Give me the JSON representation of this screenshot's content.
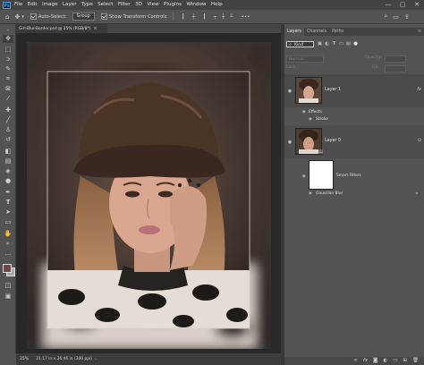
{
  "menubar": {
    "logo": "Ps",
    "items": [
      "File",
      "Edit",
      "Image",
      "Layer",
      "Type",
      "Select",
      "Filter",
      "3D",
      "View",
      "Plugins",
      "Window",
      "Help"
    ],
    "window_controls": [
      "—",
      "▢",
      "✕"
    ]
  },
  "options": {
    "auto_select_label": "Auto-Select:",
    "auto_select_value": "Group",
    "show_transform_label": "Show Transform Controls"
  },
  "document": {
    "tab_title": "Girl-Blur-Border.psd @ 25% (RGB/8*)",
    "zoom": "25%",
    "doc_info": "21.17 in x 26.46 in (300 ppi)"
  },
  "panels": {
    "tabs": [
      "Layers",
      "Channels",
      "Paths"
    ],
    "active_tab": "Layers",
    "filter_kind": "Kind",
    "blend_mode": "Normal",
    "opacity_label": "Opacity:",
    "fill_label": "Fill:",
    "lock_label": "Lock:",
    "layers": [
      {
        "name": "Layer 1",
        "effects_label": "Effects",
        "effect": "Stroke"
      },
      {
        "name": "Layer 0",
        "smart_filters_label": "Smart Filters",
        "filter": "Gaussian Blur"
      }
    ]
  },
  "colors": {
    "app_bg": "#535353",
    "canvas_bg": "#282828",
    "accent": "#31a8ff",
    "foreground_swatch": "#6c4848",
    "background_swatch": "#a8a8a8"
  },
  "icons": {
    "tools": [
      "move-tool",
      "artboard-tool",
      "marquee-tool",
      "lasso-tool",
      "quick-select-tool",
      "crop-tool",
      "frame-tool",
      "eyedropper-tool",
      "spot-heal-tool",
      "brush-tool",
      "clone-stamp-tool",
      "history-brush-tool",
      "eraser-tool",
      "gradient-tool",
      "blur-tool",
      "dodge-tool",
      "pen-tool",
      "type-tool",
      "path-select-tool",
      "rectangle-tool",
      "hand-tool",
      "zoom-tool",
      "more-tools"
    ]
  }
}
